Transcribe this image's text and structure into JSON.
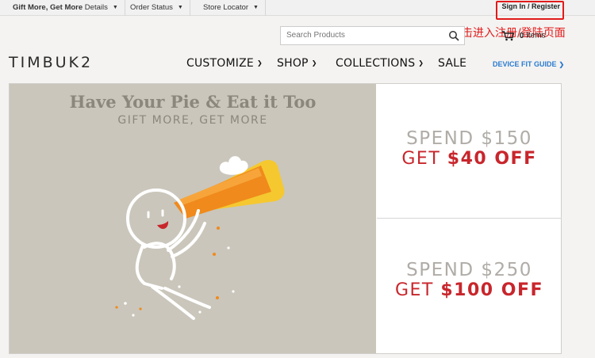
{
  "topbar": {
    "promo_bold": "Gift More, Get More",
    "promo_rest": " Details",
    "order_status": "Order Status",
    "store_locator": "Store Locator",
    "sign_in": "Sign In / Register"
  },
  "annotation": "点击进入注册/登陆页面",
  "search": {
    "placeholder": "Search Products"
  },
  "cart": {
    "count": "0",
    "label": "Items"
  },
  "logo": "TIMBUK2",
  "nav": {
    "items": [
      {
        "label": "CUSTOMIZE"
      },
      {
        "label": "SHOP"
      },
      {
        "label": "COLLECTIONS"
      },
      {
        "label": "SALE"
      }
    ],
    "fit_guide": "DEVICE FIT GUIDE"
  },
  "banner": {
    "title": "Have Your Pie & Eat it Too",
    "subtitle": "GIFT MORE, GET MORE",
    "offers": [
      {
        "spend": "SPEND $150",
        "get_prefix": "GET ",
        "get_amount": "$40 OFF"
      },
      {
        "spend": "SPEND $250",
        "get_prefix": "GET ",
        "get_amount": "$100 OFF"
      }
    ]
  },
  "colors": {
    "accent_red": "#c8262c",
    "link_blue": "#2a7bd0",
    "hero_bg": "#cac6bb",
    "pie_orange": "#f08a1c",
    "crust_yellow": "#f5c830"
  }
}
